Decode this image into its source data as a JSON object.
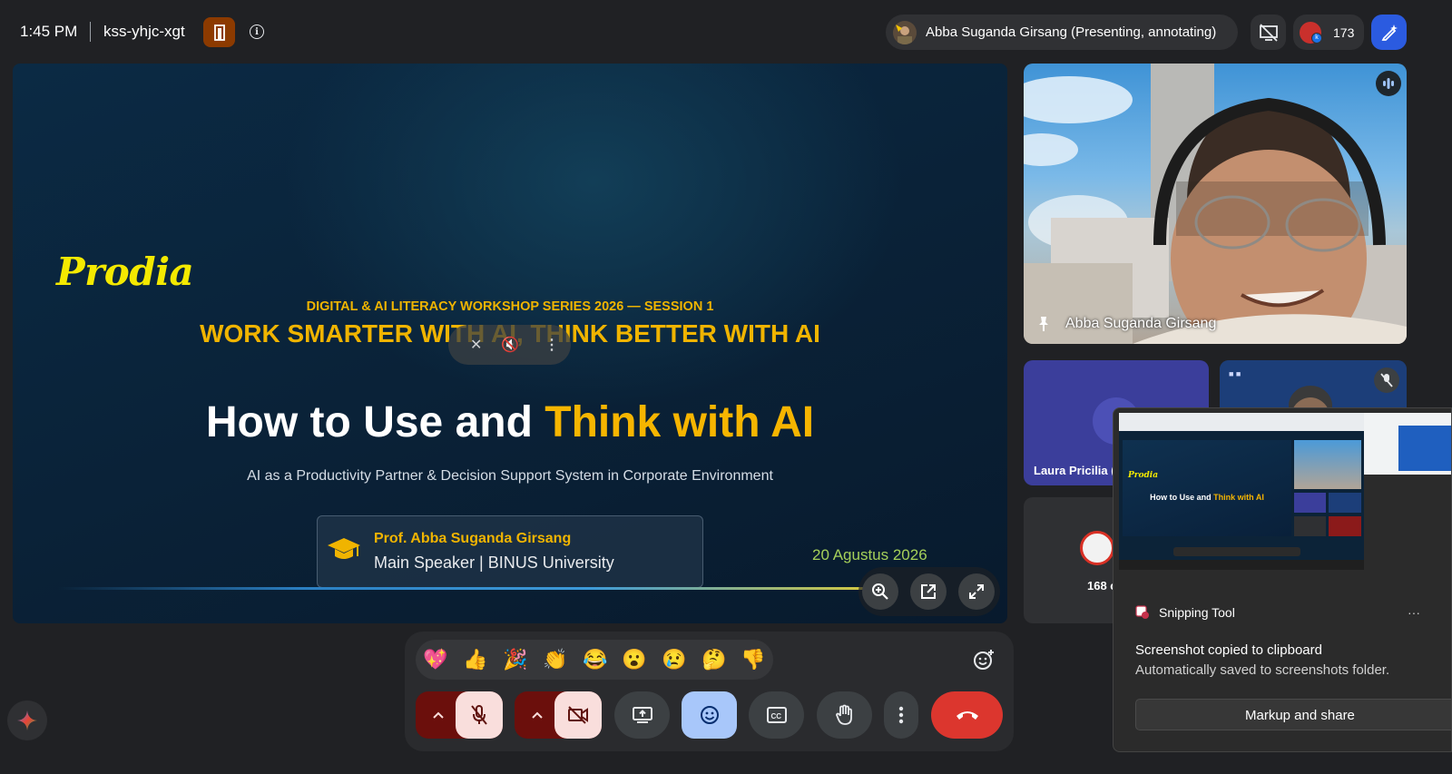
{
  "topbar": {
    "time": "1:45 PM",
    "meeting_code": "kss-yhjc-xgt",
    "presenter_label": "Abba Suganda Girsang (Presenting, annotating)",
    "people_count": "173"
  },
  "slide": {
    "logo": "Prodia",
    "series": "DIGITAL & AI LITERACY WORKSHOP SERIES 2026 — SESSION 1",
    "theme": "WORK SMARTER WITH AI, THINK BETTER WITH AI",
    "title_part1": "How to Use and ",
    "title_part2": "Think with AI",
    "subtitle": "AI as a Productivity Partner & Decision Support System in Corporate Environment",
    "speaker_name": "Prof. Abba Suganda Girsang",
    "speaker_role": "Main Speaker | BINUS University",
    "date": "20 Agustus 2026"
  },
  "tiles": {
    "main_name": "Abba Suganda Girsang",
    "laura_name": "Laura Pricilia (Y",
    "others_label": "168 o"
  },
  "snip": {
    "thumb_logo": "Prodia",
    "thumb_title_part1": "How to Use and ",
    "thumb_title_part2": "Think with AI",
    "app_name": "Snipping Tool",
    "more": "···",
    "heading": "Screenshot copied to clipboard",
    "detail": "Automatically saved to screenshots folder.",
    "button": "Markup and share"
  },
  "reactions": [
    {
      "name": "sparkling-heart",
      "glyph": "💖"
    },
    {
      "name": "thumbs-up",
      "glyph": "👍"
    },
    {
      "name": "party-popper",
      "glyph": "🎉"
    },
    {
      "name": "clapping-hands",
      "glyph": "👏"
    },
    {
      "name": "tears-of-joy",
      "glyph": "😂"
    },
    {
      "name": "surprised",
      "glyph": "😮"
    },
    {
      "name": "crying",
      "glyph": "😢"
    },
    {
      "name": "thinking",
      "glyph": "🤔"
    },
    {
      "name": "thumbs-down",
      "glyph": "👎"
    }
  ],
  "colors": {
    "accent_yellow": "#f0b400",
    "leave_red": "#dc362e",
    "muted_pink": "#f9dedc",
    "reaction_active": "#a8c7fa"
  }
}
